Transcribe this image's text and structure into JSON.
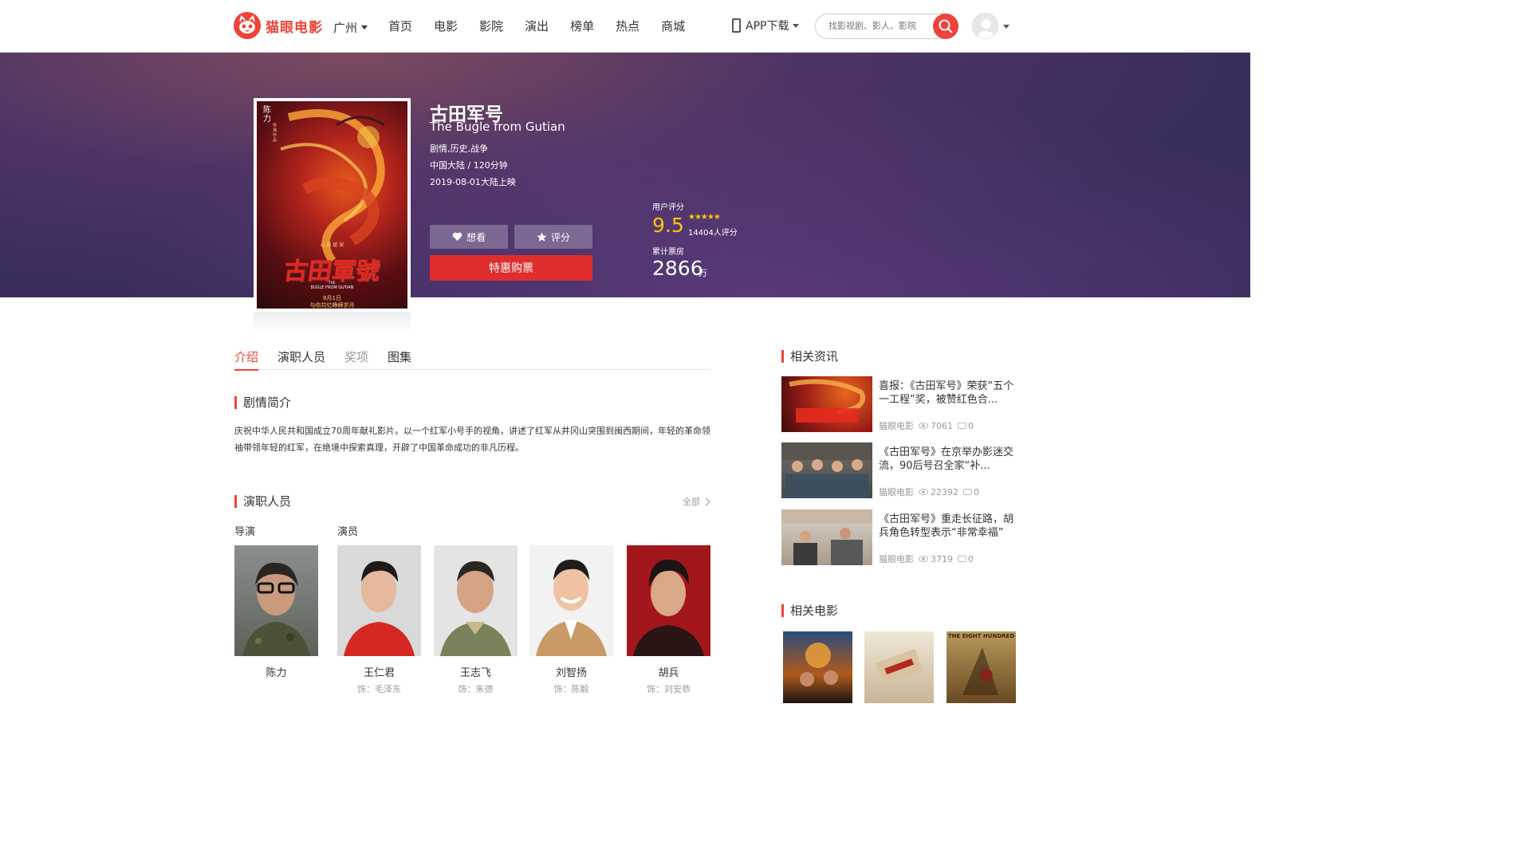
{
  "header": {
    "logo_text": "猫眼电影",
    "city": "广州",
    "nav": [
      "首页",
      "电影",
      "影院",
      "演出",
      "榜单",
      "热点",
      "商城"
    ],
    "app_download": "APP下载",
    "search_placeholder": "找影视剧、影人、影院"
  },
  "movie": {
    "title": "古田军号",
    "title_en": "The Bugle from Gutian",
    "genres": "剧情,历史,战争",
    "region_duration": "中国大陆 / 120分钟",
    "release": "2019-08-01大陆上映",
    "want_label": "想看",
    "rate_label": "评分",
    "buy_label": "特惠购票",
    "rating_label": "用户评分",
    "score": "9.5",
    "stars": "★★★★★",
    "rating_count": "14404人评分",
    "box_office_label": "累计票房",
    "box_office": "2866",
    "box_office_unit": "万",
    "poster_text": {
      "director_vertical": "陈力",
      "director_sub": "导演作品",
      "tagline_top": "心 向 延 安",
      "title_art": "古田軍號",
      "en_line1": "THE",
      "en_line2": "BUGLE FROM GUTIAN",
      "date": "8月1日",
      "slogan": "与你共忆峥嵘岁月"
    }
  },
  "tabs": [
    "介绍",
    "演职人员",
    "奖项",
    "图集"
  ],
  "synopsis": {
    "title": "剧情简介",
    "text": "庆祝中华人民共和国成立70周年献礼影片。以一个红军小号手的视角，讲述了红军从井冈山突围到闽西期间，年轻的革命领袖带领年轻的红军，在绝境中探索真理，开辟了中国革命成功的非凡历程。"
  },
  "cast": {
    "title": "演职人员",
    "all_label": "全部",
    "director_head": "导演",
    "actor_head": "演员",
    "people": [
      {
        "name": "陈力",
        "role": ""
      },
      {
        "name": "王仁君",
        "role": "饰：毛泽东"
      },
      {
        "name": "王志飞",
        "role": "饰：朱德"
      },
      {
        "name": "刘智扬",
        "role": "饰：陈毅"
      },
      {
        "name": "胡兵",
        "role": "饰：刘安恭"
      }
    ]
  },
  "news": {
    "title": "相关资讯",
    "items": [
      {
        "title": "喜报：《古田军号》荣获“五个一工程”奖，被赞红色合...",
        "source": "猫眼电影",
        "views": "7061",
        "comments": "0"
      },
      {
        "title": "《古田军号》在京举办影迷交流，90后号召全家“补...",
        "source": "猫眼电影",
        "views": "22392",
        "comments": "0"
      },
      {
        "title": "《古田军号》重走长征路，胡兵角色转型表示“非常幸福”",
        "source": "猫眼电影",
        "views": "3719",
        "comments": "0"
      }
    ]
  },
  "related": {
    "title": "相关电影",
    "poster3_text": "THE EIGHT HUNDRED"
  },
  "colors": {
    "accent": "#ef4238",
    "score": "#ffc600",
    "banner": "#3b2c5e"
  }
}
